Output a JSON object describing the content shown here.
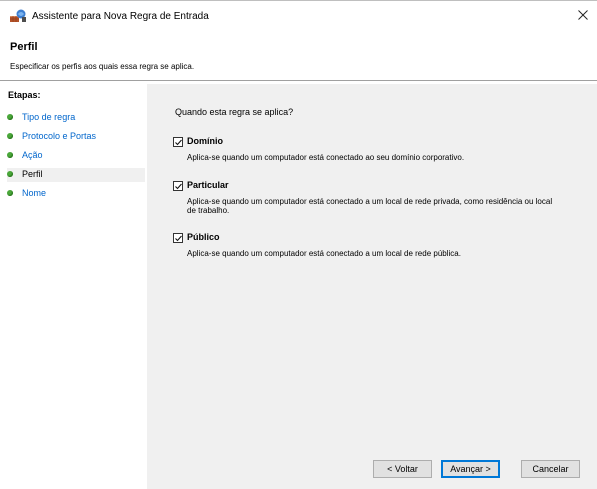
{
  "window": {
    "title": "Assistente para Nova Regra de Entrada",
    "close_glyph": "✕",
    "app_icon": "firewall-icon"
  },
  "header": {
    "title": "Perfil",
    "subtitle": "Especificar os perfis aos quais essa regra se aplica."
  },
  "sidebar": {
    "heading": "Etapas:",
    "items": [
      {
        "label": "Tipo de regra",
        "current": false
      },
      {
        "label": "Protocolo e Portas",
        "current": false
      },
      {
        "label": "Ação",
        "current": false
      },
      {
        "label": "Perfil",
        "current": true
      },
      {
        "label": "Nome",
        "current": false
      }
    ]
  },
  "main": {
    "question": "Quando esta regra se aplica?",
    "options": [
      {
        "label": "Domínio",
        "checked": true,
        "description": "Aplica-se quando um computador está conectado ao seu domínio corporativo."
      },
      {
        "label": "Particular",
        "checked": true,
        "description": "Aplica-se quando um computador está conectado a um local de rede privada, como residência ou local de trabalho."
      },
      {
        "label": "Público",
        "checked": true,
        "description": "Aplica-se quando um computador está conectado a um local de rede pública."
      }
    ]
  },
  "buttons": {
    "back": "< Voltar",
    "next": "Avançar >",
    "cancel": "Cancelar"
  },
  "colors": {
    "content_bg": "#f0f0f0",
    "step_link": "#0066cc",
    "step_dot": "#4aa83a",
    "primary_border": "#0078d7"
  }
}
